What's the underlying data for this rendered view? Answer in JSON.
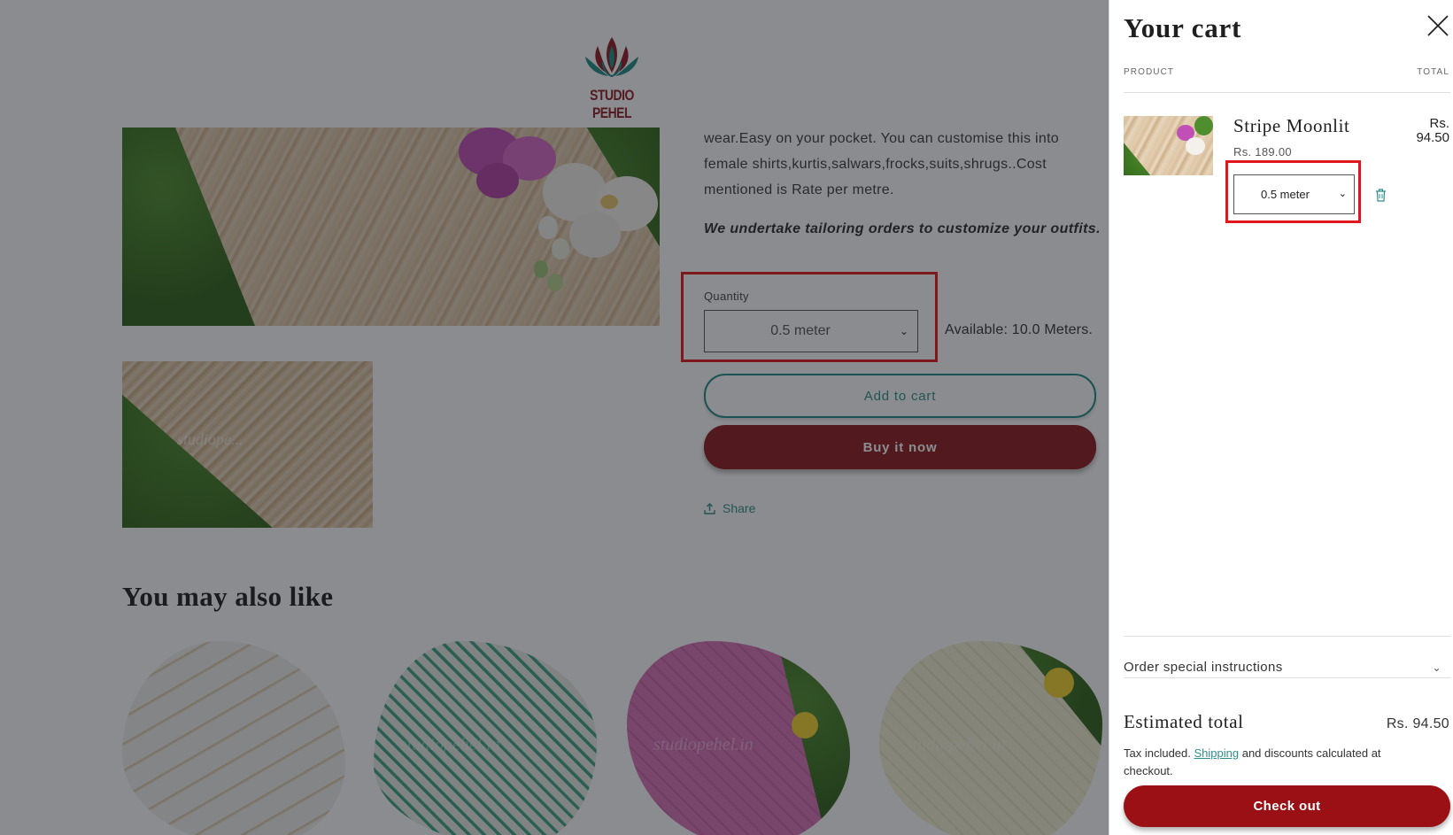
{
  "brand": {
    "name": "STUDIO PEHEL"
  },
  "product": {
    "description": "wear.Easy on your pocket. You can customise this into female shirts,kurtis,salwars,frocks,suits,shrugs..Cost mentioned is Rate per metre.",
    "tailoring_note": "We undertake tailoring orders to customize your outfits.",
    "quantity_label": "Quantity",
    "quantity_value": "0.5 meter",
    "availability": "Available: 10.0 Meters.",
    "add_to_cart": "Add to cart",
    "buy_now": "Buy it now",
    "share": "Share",
    "thumb_watermark": "studiope..."
  },
  "recommendations": {
    "heading": "You may also like",
    "watermark": "studiopehel.in"
  },
  "cart": {
    "title": "Your cart",
    "col_product": "PRODUCT",
    "col_total": "TOTAL",
    "item": {
      "title": "Stripe Moonlit",
      "unit_price": "Rs. 189.00",
      "line_total_currency": "Rs.",
      "line_total_amount": "94.50",
      "quantity_value": "0.5 meter"
    },
    "instructions_label": "Order special instructions",
    "estimated_total_label": "Estimated total",
    "estimated_total_value": "Rs. 94.50",
    "tax_prefix": "Tax included. ",
    "shipping_link": "Shipping",
    "tax_suffix": " and discounts calculated at checkout.",
    "checkout": "Check out"
  },
  "colors": {
    "accent_teal": "#2d8f8a",
    "buy_button": "#8c1a1e",
    "checkout_button": "#9a1014",
    "highlight_box": "#e0171c",
    "overlay": "rgba(24,26,32,0.5)"
  },
  "icons": [
    "lotus-logo-icon",
    "chevron-down-icon",
    "share-icon",
    "close-icon",
    "trash-icon"
  ]
}
